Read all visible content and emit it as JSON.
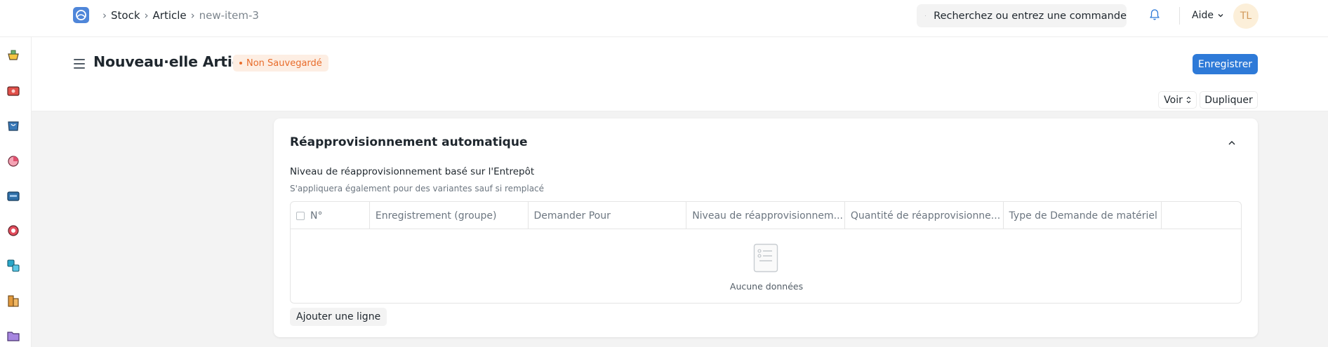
{
  "navbar": {
    "breadcrumbs": [
      "Stock",
      "Article",
      "new-item-3"
    ],
    "search_placeholder": "Recherchez ou entrez une commande",
    "help_label": "Aide",
    "avatar_initials": "TL"
  },
  "sidebar": {
    "icons": [
      "stock-icon",
      "selling-icon",
      "buying-icon",
      "accounting-icon",
      "assets-icon",
      "support-icon",
      "projects-icon",
      "organization-icon",
      "folder-icon"
    ]
  },
  "page": {
    "title": "Nouveau·elle Article",
    "status_badge": "Non Sauvegardé",
    "save_label": "Enregistrer",
    "view_label": "Voir",
    "duplicate_label": "Dupliquer"
  },
  "section": {
    "title": "Réapprovisionnement automatique",
    "field_label": "Niveau de réapprovisionnement basé sur l'Entrepôt",
    "field_description": "S'appliquera également pour des variantes sauf si remplacé",
    "table": {
      "columns": [
        "N°",
        "Enregistrement (groupe)",
        "Demander Pour",
        "Niveau de réapprovisionnem...",
        "Quantité de réapprovisionne...",
        "Type de Demande de matériel"
      ],
      "empty_text": "Aucune données"
    },
    "add_row_label": "Ajouter une ligne"
  },
  "colors": {
    "primary": "#2e7ad8",
    "warning_badge_bg": "#fdeee3",
    "warning_badge_text": "#e86c2b"
  }
}
